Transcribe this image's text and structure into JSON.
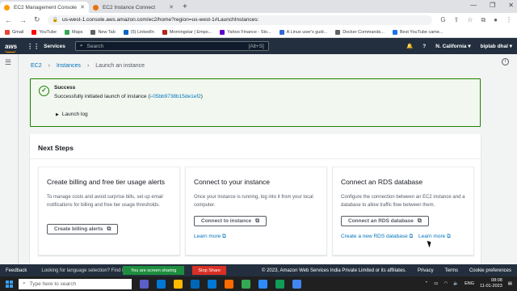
{
  "browser": {
    "tabs": [
      {
        "label": "EC2 Management Console",
        "active": true
      },
      {
        "label": "EC2 Instance Connect",
        "active": false
      }
    ],
    "url": "us-west-1.console.aws.amazon.com/ec2/home?region=us-west-1#LaunchInstances:",
    "bookmarks": [
      {
        "label": "Gmail",
        "color": "#ea4335"
      },
      {
        "label": "YouTube",
        "color": "#ff0000"
      },
      {
        "label": "Maps",
        "color": "#34a853"
      },
      {
        "label": "New Tab",
        "color": "#5f6368"
      },
      {
        "label": "(5) LinkedIn",
        "color": "#0a66c2"
      },
      {
        "label": "Morningstar | Empo...",
        "color": "#b3261e"
      },
      {
        "label": "Yahoo Finance - Sto...",
        "color": "#6001d2"
      },
      {
        "label": "A Linux user's guid...",
        "color": "#3367d6"
      },
      {
        "label": "Docker Commands...",
        "color": "#5f6368"
      },
      {
        "label": "Best YouTube came...",
        "color": "#1a73e8"
      }
    ]
  },
  "aws_nav": {
    "logo": "aws",
    "services": "Services",
    "search_placeholder": "Search",
    "search_shortcut": "[Alt+S]",
    "region": "N. California ▾",
    "user": "biplab dhal ▾"
  },
  "breadcrumb": {
    "items": [
      "EC2",
      "Instances",
      "Launch an instance"
    ],
    "separator": "›"
  },
  "alert": {
    "title": "Success",
    "message_prefix": "Successfully initiated launch of instance (",
    "instance_id": "i-05bb9738b15de1ef2",
    "message_suffix": ")",
    "launch_log": "Launch log",
    "status_color": "#1d8102"
  },
  "next_steps": {
    "heading": "Next Steps",
    "cards": [
      {
        "title": "Create billing and free tier usage alerts",
        "description": "To manage costs and avoid surprise bills, set up email notifications for billing and free tier usage thresholds.",
        "button": "Create billing alerts"
      },
      {
        "title": "Connect to your instance",
        "description": "Once your instance is running, log into it from your local computer.",
        "button": "Connect to instance",
        "link": "Learn more"
      },
      {
        "title": "Connect an RDS database",
        "description": "Configure the connection between an EC2 instance and a database to allow traffic flow between them.",
        "button": "Connect an RDS database",
        "link": "Create a new RDS database",
        "link2": "Learn more"
      }
    ]
  },
  "footer": {
    "feedback": "Feedback",
    "language": "Looking for language selection? Find it in",
    "sharing": "You are screen sharing",
    "stop_share": "Stop Share",
    "copyright": "© 2023, Amazon Web Services India Private Limited or its affiliates.",
    "privacy": "Privacy",
    "terms": "Terms",
    "cookies": "Cookie preferences"
  },
  "taskbar": {
    "search_placeholder": "Type here to search",
    "language": "ENG",
    "time": "08:08",
    "date": "11-01-2023"
  },
  "icons": {
    "external": "external-link-icon",
    "check": "check-circle-icon"
  }
}
